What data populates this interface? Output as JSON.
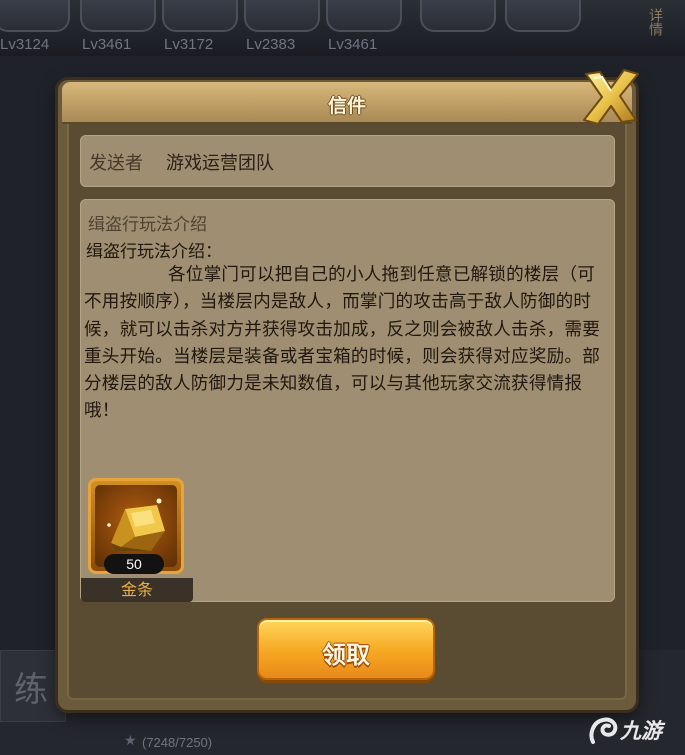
{
  "background": {
    "levels": [
      "Lv3124",
      "Lv3461",
      "Lv3172",
      "Lv2383",
      "Lv3461"
    ],
    "side_text": "详情",
    "side_glyph": "练",
    "progress": "(7248/7250)"
  },
  "dialog": {
    "title": "信件",
    "sender_label": "发送者",
    "sender_value": "游戏运营团队",
    "subject": "缉盗行玩法介绍",
    "heading": "缉盗行玩法介绍：",
    "body": "各位掌门可以把自己的小人拖到任意已解锁的楼层（可不用按顺序），当楼层内是敌人，而掌门的攻击高于敌人防御的时候，就可以击杀对方并获得攻击加成，反之则会被敌人击杀，需要重头开始。当楼层是装备或者宝箱的时候，则会获得对应奖励。部分楼层的敌人防御力是未知数值，可以与其他玩家交流获得情报哦！",
    "attachment": {
      "name": "金条",
      "count": "50",
      "icon": "gold-bar-icon"
    },
    "claim_label": "领取",
    "close_icon": "close-x-icon"
  },
  "watermark": {
    "text": "九游",
    "logo_icon": "jiuyou-logo-icon"
  },
  "colors": {
    "panel": "#5a4b33",
    "text_box": "#9f8e71",
    "accent_gold": "#f6a722",
    "item_name": "#e8b044"
  }
}
